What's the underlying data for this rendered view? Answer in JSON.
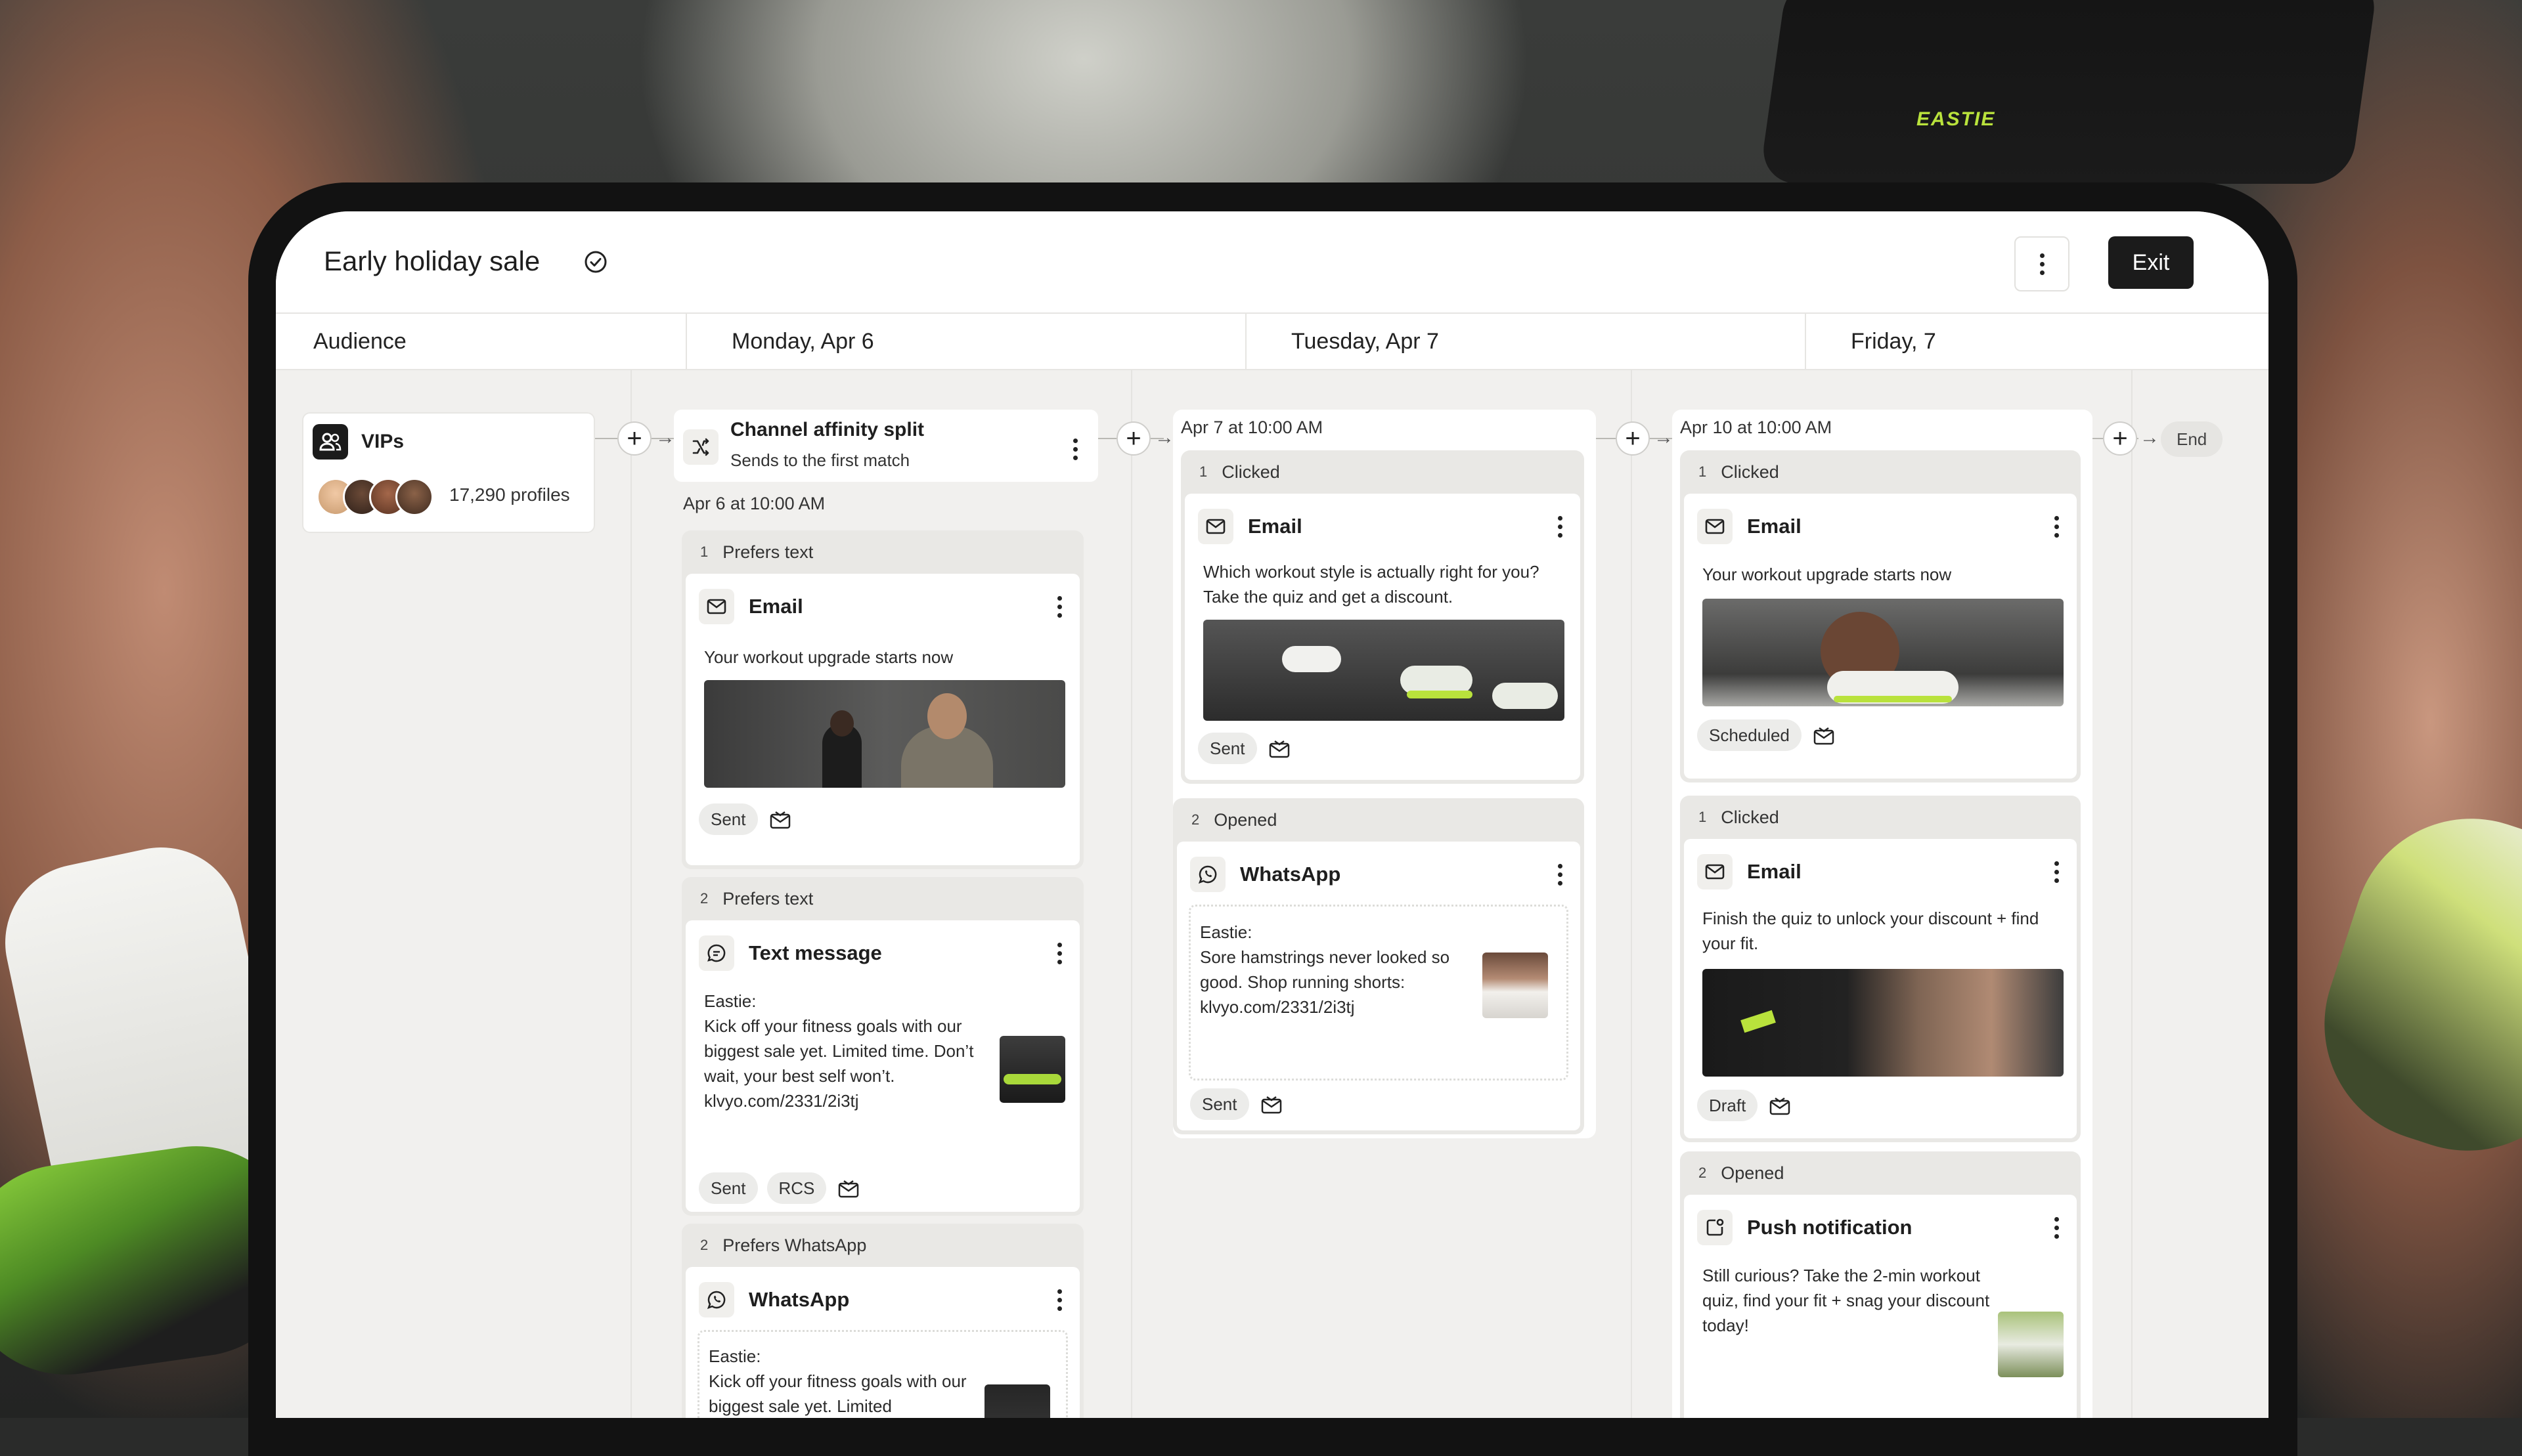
{
  "app": {
    "title": "Early holiday sale",
    "exit_label": "Exit"
  },
  "columns": [
    {
      "label": "Audience"
    },
    {
      "label": "Monday, Apr  6"
    },
    {
      "label": "Tuesday, Apr  7"
    },
    {
      "label": "Friday,  7"
    }
  ],
  "audience": {
    "name": "VIPs",
    "profiles": "17,290 profiles"
  },
  "split": {
    "title": "Channel affinity split",
    "subtitle": "Sends to the first match",
    "date": "Apr 6 at 10:00 AM",
    "branches": [
      {
        "num": "1",
        "condition": "Prefers text",
        "channel": "Email",
        "body": "Your workout upgrade starts now",
        "chips": [
          "Sent"
        ]
      },
      {
        "num": "2",
        "condition": "Prefers text",
        "channel": "Text message",
        "body": "Eastie:\nKick off your fitness goals with our biggest sale yet. Limited time. Don’t wait, your best self won’t. klvyo.com/2331/2i3tj",
        "chips": [
          "Sent",
          "RCS"
        ]
      },
      {
        "num": "2",
        "condition": "Prefers WhatsApp",
        "channel": "WhatsApp",
        "body": "Eastie:\nKick off your fitness goals with our biggest sale yet. Limited"
      }
    ]
  },
  "tuesday": {
    "date": "Apr 7 at 10:00 AM",
    "groups": [
      {
        "num": "1",
        "condition": "Clicked",
        "channel": "Email",
        "body": "Which workout style is actually right for you? Take the quiz and get a discount.",
        "chips": [
          "Sent"
        ]
      },
      {
        "num": "2",
        "condition": "Opened",
        "channel": "WhatsApp",
        "body": "Eastie:\nSore hamstrings never looked so good. Shop running shorts: klvyo.com/2331/2i3tj",
        "chips": [
          "Sent"
        ]
      }
    ]
  },
  "friday": {
    "date": "Apr 10 at 10:00 AM",
    "end_label": "End",
    "groups": [
      {
        "num": "1",
        "condition": "Clicked",
        "channel": "Email",
        "body": "Your workout upgrade starts now",
        "chips": [
          "Scheduled"
        ]
      },
      {
        "num": "1",
        "condition": "Clicked",
        "channel": "Email",
        "body": "Finish the quiz to unlock your discount + find your fit.",
        "chips": [
          "Draft"
        ]
      },
      {
        "num": "2",
        "condition": "Opened",
        "channel": "Push notification",
        "body": "Still curious? Take the 2-min workout quiz, find your fit + snag your discount today!"
      }
    ]
  },
  "background": {
    "brand_text": "EASTIE"
  }
}
